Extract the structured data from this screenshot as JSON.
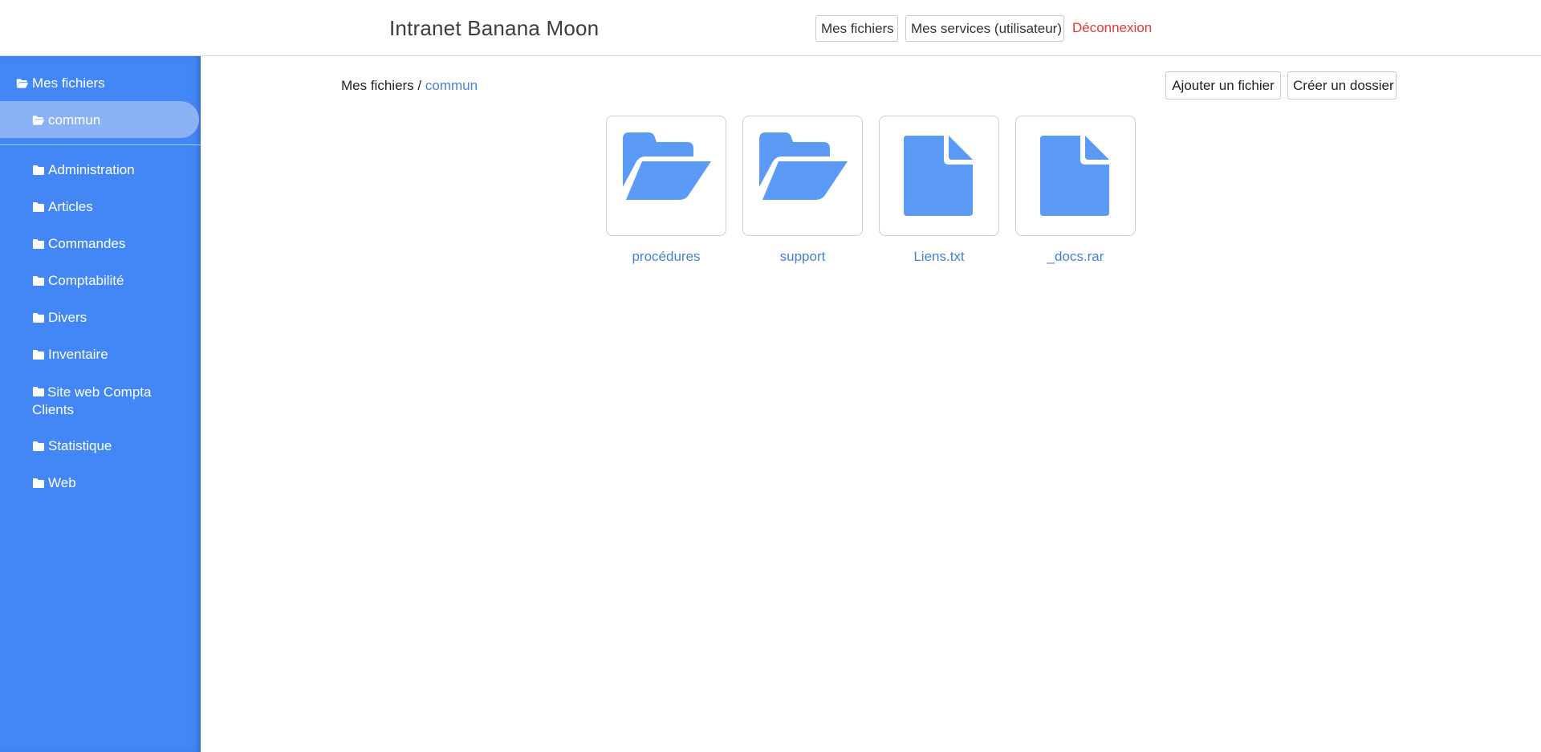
{
  "header": {
    "title": "Intranet Banana Moon",
    "nav_my_files": "Mes fichiers",
    "nav_my_services": "Mes services (utilisateur)",
    "logout": "Déconnexion"
  },
  "sidebar": {
    "root": {
      "label": "Mes fichiers",
      "icon": "folder-open-icon"
    },
    "active": {
      "label": "commun",
      "icon": "folder-open-icon"
    },
    "folders": [
      {
        "label": "Administration",
        "icon": "folder-icon"
      },
      {
        "label": "Articles",
        "icon": "folder-icon"
      },
      {
        "label": "Commandes",
        "icon": "folder-icon"
      },
      {
        "label": "Comptabilité",
        "icon": "folder-icon"
      },
      {
        "label": "Divers",
        "icon": "folder-icon"
      },
      {
        "label": "Inventaire",
        "icon": "folder-icon"
      },
      {
        "label": "Site web Compta Clients",
        "icon": "folder-icon"
      },
      {
        "label": "Statistique",
        "icon": "folder-icon"
      },
      {
        "label": "Web",
        "icon": "folder-icon"
      }
    ]
  },
  "breadcrumb": {
    "root": "Mes fichiers",
    "separator": " / ",
    "current": "commun"
  },
  "actions": {
    "add_file": "Ajouter un fichier",
    "new_folder": "Créer un dossier"
  },
  "items": [
    {
      "name": "procédures",
      "type": "folder",
      "icon": "folder-open-icon"
    },
    {
      "name": "support",
      "type": "folder",
      "icon": "folder-open-icon"
    },
    {
      "name": "Liens.txt",
      "type": "file",
      "icon": "file-icon"
    },
    {
      "name": "_docs.rar",
      "type": "file",
      "icon": "file-icon"
    }
  ],
  "colors": {
    "sidebar": "#4287f5",
    "sidebar_active": "#8ab2f5",
    "accent": "#4a7fd9",
    "icon_fill": "#5b9af5",
    "logout": "#e53935"
  }
}
